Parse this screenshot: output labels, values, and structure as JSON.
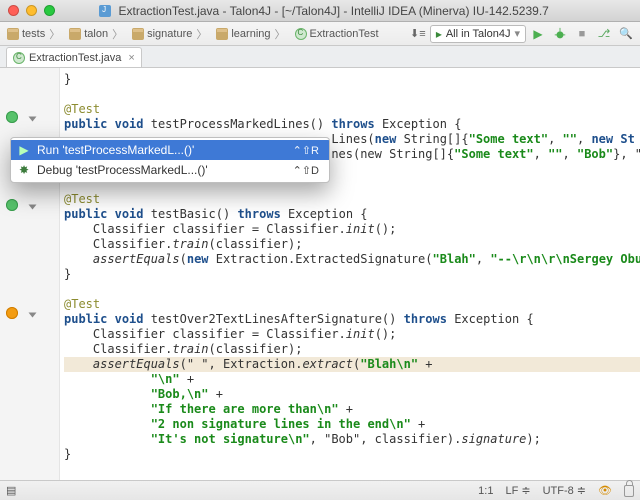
{
  "window": {
    "title": "ExtractionTest.java - Talon4J - [~/Talon4J] - IntelliJ IDEA (Minerva) IU-142.5239.7"
  },
  "breadcrumb": [
    "tests",
    "talon",
    "signature",
    "learning",
    "ExtractionTest"
  ],
  "run_config": {
    "label": "All in Talon4J"
  },
  "tab": {
    "label": "ExtractionTest.java"
  },
  "context_menu": {
    "items": [
      {
        "label": "Run 'testProcessMarkedL...()'",
        "shortcut": "⌃⇧R",
        "icon": "run",
        "selected": true
      },
      {
        "label": "Debug 'testProcessMarkedL...()'",
        "shortcut": "⌃⇧D",
        "icon": "bug",
        "selected": false
      }
    ]
  },
  "code": {
    "ann_test": "@Test",
    "kw_public": "public",
    "kw_void": "void",
    "kw_throws": "throws",
    "kw_new": "new",
    "method1": "testProcessMarkedLines()",
    "method2": "testBasic()",
    "method3": "testOver2TextLinesAfterSignature()",
    "exc": "Exception",
    "frag_lines": "Lines(",
    "frag_new_string_arr": "new String[]{",
    "frag_nes": "nes(new String[]{",
    "str_some_text": "\"Some text\"",
    "str_empty": "\"\"",
    "kw_new_str": "new St",
    "str_bob": "\"Bob\"",
    "line_cls_init": "Classifier classifier = Classifier.",
    "mtd_init": "init",
    "line_cls_train": "Classifier.",
    "mtd_train": "train",
    "train_arg": "(classifier);",
    "mtd_assertEquals": "assertEquals",
    "extr_sig": "Extraction.ExtractedSignature(",
    "str_blah": "\"Blah\"",
    "str_dashes": "\"--\\r\\n\\r\\nSergey Obuk",
    "ae_space": "(\" \"",
    "extr_call": ", Extraction.",
    "mtd_extract": "extract",
    "str_blah_n": "\"Blah\\n\"",
    "plus": " +",
    "s_n": "\"\\n\"",
    "s_bob": "\"Bob,\\n\"",
    "s_if": "\"If there are more than\\n\"",
    "s_2non": "\"2 non signature lines in the end\\n\"",
    "s_notsig": "\"It's not signature\\n\"",
    "tail_bob": ", \"Bob\", classifier).",
    "mtd_sig": "signature",
    "tail_end": ");"
  },
  "status": {
    "pos": "1:1",
    "line_sep": "LF",
    "encoding": "UTF-8"
  }
}
